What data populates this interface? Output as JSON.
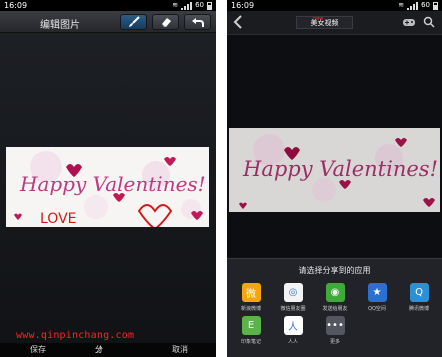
{
  "left_phone": {
    "status": {
      "time": "16:09",
      "battery": "60"
    },
    "toolbar": {
      "title": "编辑图片"
    },
    "image": {
      "text": "Happy Valentines!",
      "doodle": "LOVE"
    },
    "watermark": "www.qinpinchang.com",
    "bottom": {
      "save": "保存",
      "share": "分享",
      "cancel": "取消"
    }
  },
  "right_phone": {
    "status": {
      "time": "16:09",
      "battery": "60"
    },
    "header": {
      "title": "美女视频",
      "mark": "new"
    },
    "image": {
      "text": "Happy Valentines!"
    },
    "share_sheet": {
      "title": "请选择分享到的应用",
      "apps": [
        {
          "label": "新浪微博",
          "icon": "weibo-icon",
          "color": "#f4a70c",
          "glyph": "微"
        },
        {
          "label": "微信朋友圈",
          "icon": "moments-icon",
          "color": "#f3f3f3",
          "glyph": "◎"
        },
        {
          "label": "发送给朋友",
          "icon": "wechat-icon",
          "color": "#3fa93a",
          "glyph": "◉"
        },
        {
          "label": "QQ空间",
          "icon": "qzone-icon",
          "color": "#2b6fd1",
          "glyph": "★"
        },
        {
          "label": "腾讯微博",
          "icon": "tencent-weibo-icon",
          "color": "#2e8fd6",
          "glyph": "Q"
        },
        {
          "label": "印象笔记",
          "icon": "evernote-icon",
          "color": "#5bb44a",
          "glyph": "E"
        },
        {
          "label": "人人",
          "icon": "renren-icon",
          "color": "#ffffff",
          "glyph": "人"
        },
        {
          "label": "更多",
          "icon": "more-icon",
          "color": "#555760",
          "glyph": "•••"
        }
      ]
    }
  }
}
